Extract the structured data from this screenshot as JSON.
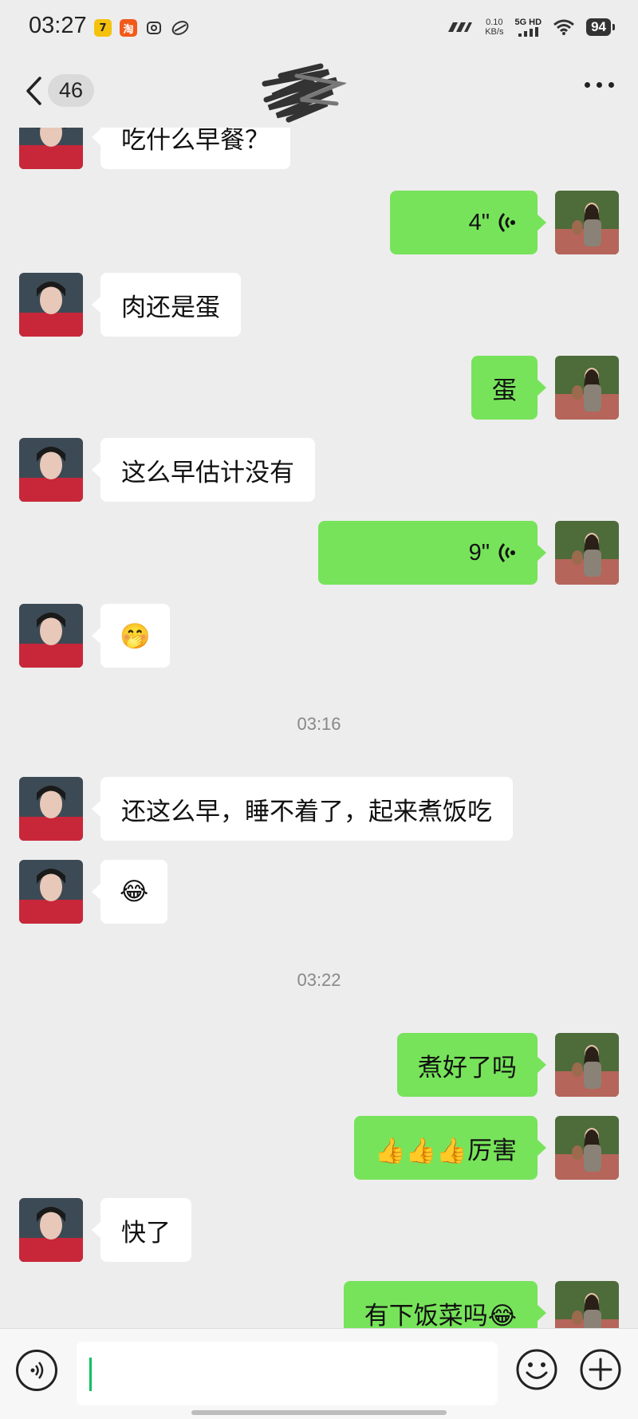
{
  "status_bar": {
    "time": "03:27",
    "net_speed_value": "0.10",
    "net_speed_unit": "KB/s",
    "network": "5G HD",
    "battery": "94"
  },
  "header": {
    "unread_count": "46"
  },
  "messages": [
    {
      "side": "in",
      "type": "text",
      "text": "吃什么早餐？"
    },
    {
      "side": "out",
      "type": "voice",
      "text": "4\""
    },
    {
      "side": "in",
      "type": "text",
      "text": "肉还是蛋"
    },
    {
      "side": "out",
      "type": "text",
      "text": "蛋"
    },
    {
      "side": "in",
      "type": "text",
      "text": "这么早估计没有"
    },
    {
      "side": "out",
      "type": "voice",
      "text": "9\""
    },
    {
      "side": "in",
      "type": "emoji",
      "text": "🤭"
    },
    {
      "type": "time",
      "text": "03:16"
    },
    {
      "side": "in",
      "type": "text",
      "text": "还这么早，睡不着了，起来煮饭吃"
    },
    {
      "side": "in",
      "type": "emoji",
      "text": "😂"
    },
    {
      "type": "time",
      "text": "03:22"
    },
    {
      "side": "out",
      "type": "text",
      "text": "煮好了吗"
    },
    {
      "side": "out",
      "type": "text",
      "text": "👍👍👍厉害"
    },
    {
      "side": "in",
      "type": "text",
      "text": "快了"
    },
    {
      "side": "out",
      "type": "text",
      "text": "有下饭菜吗😂"
    }
  ],
  "input_bar": {
    "placeholder": ""
  },
  "colors": {
    "outgoing_bubble": "#77e35a",
    "incoming_bubble": "#ffffff",
    "background": "#ededed",
    "cursor": "#07c160"
  },
  "icons": {
    "back": "chevron-left-icon",
    "more": "more-dots-icon",
    "voice_input": "voice-icon",
    "emoji": "emoji-icon",
    "plus": "plus-icon",
    "voice_wave": "voice-wave-icon"
  }
}
